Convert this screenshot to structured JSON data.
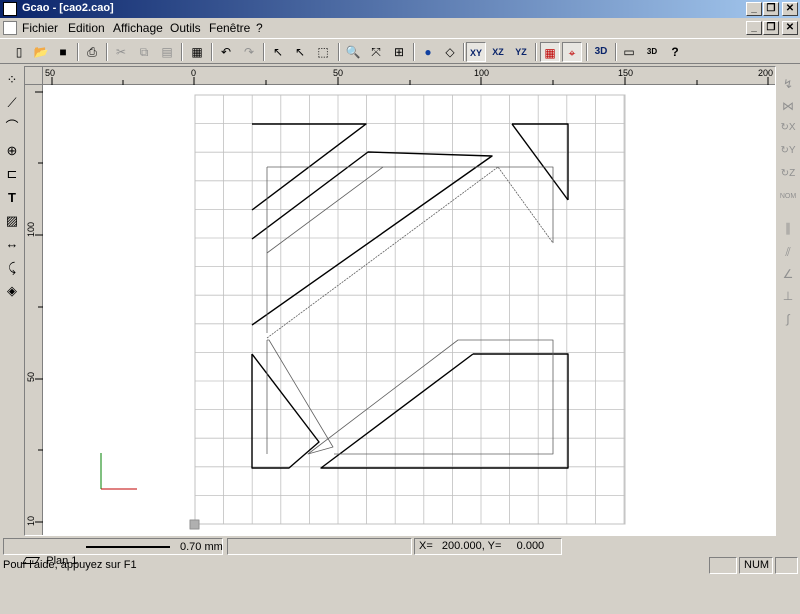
{
  "window": {
    "title": "Gcao - [cao2.cao]",
    "controls": [
      "_",
      "❐",
      "✕"
    ]
  },
  "menubar": {
    "items": [
      "Fichier",
      "Edition",
      "Affichage",
      "Outils",
      "Fenêtre",
      "?"
    ],
    "doc_controls": [
      "_",
      "❐",
      "✕"
    ]
  },
  "toolbar": {
    "buttons": [
      {
        "name": "new-icon",
        "glyph": "▯"
      },
      {
        "name": "open-icon",
        "glyph": "📂"
      },
      {
        "name": "save-icon",
        "glyph": "■"
      },
      {
        "name": "print-icon",
        "glyph": "⎙"
      },
      {
        "name": "cut-icon",
        "glyph": "✂"
      },
      {
        "name": "copy-icon",
        "glyph": "⧉"
      },
      {
        "name": "paste-icon",
        "glyph": "▤"
      },
      {
        "name": "properties-icon",
        "glyph": "▦"
      },
      {
        "name": "undo-icon",
        "glyph": "↶"
      },
      {
        "name": "redo-icon",
        "glyph": "↷"
      },
      {
        "name": "select-arrow-icon",
        "glyph": "↖"
      },
      {
        "name": "select-node-icon",
        "glyph": "↖"
      },
      {
        "name": "zoom-window-icon",
        "glyph": "⬚"
      },
      {
        "name": "zoom-icon",
        "glyph": "🔍"
      },
      {
        "name": "zoom-move-icon",
        "glyph": "⤧"
      },
      {
        "name": "zoom-all-icon",
        "glyph": "⊞"
      },
      {
        "name": "globe-icon",
        "glyph": "●"
      },
      {
        "name": "cube-icon",
        "glyph": "◇"
      },
      {
        "name": "view-xy",
        "glyph": "XY"
      },
      {
        "name": "view-xz",
        "glyph": "XZ"
      },
      {
        "name": "view-yz",
        "glyph": "YZ"
      },
      {
        "name": "grid-red-icon",
        "glyph": "▦"
      },
      {
        "name": "snap-red-icon",
        "glyph": "⌖"
      },
      {
        "name": "view-3d",
        "glyph": "3D"
      },
      {
        "name": "window-icon",
        "glyph": "▭"
      },
      {
        "name": "pro-3d-icon",
        "glyph": "3D"
      },
      {
        "name": "help-cursor-icon",
        "glyph": "?"
      }
    ]
  },
  "left_tools": [
    {
      "name": "points-tool-icon",
      "glyph": "⁘"
    },
    {
      "name": "polyline-tool-icon",
      "glyph": "⟋"
    },
    {
      "name": "curve-tool-icon",
      "glyph": "⌒"
    },
    {
      "name": "circle-tool-icon",
      "glyph": "⊕"
    },
    {
      "name": "rectangle-tool-icon",
      "glyph": "⊏"
    },
    {
      "name": "text-tool-icon",
      "glyph": "T"
    },
    {
      "name": "hatch-tool-icon",
      "glyph": "▨"
    },
    {
      "name": "dimension-tool-icon",
      "glyph": "↔"
    },
    {
      "name": "arc-tool-icon",
      "glyph": "⤹"
    },
    {
      "name": "fill-tool-icon",
      "glyph": "◈"
    }
  ],
  "right_tools": [
    {
      "name": "transform-icon",
      "glyph": "↯"
    },
    {
      "name": "mirror-icon",
      "glyph": "⋈"
    },
    {
      "name": "rotate-x-icon",
      "glyph": "↻X"
    },
    {
      "name": "rotate-y-icon",
      "glyph": "↻Y"
    },
    {
      "name": "rotate-z-icon",
      "glyph": "↻Z"
    },
    {
      "name": "rotate-nom-icon",
      "glyph": "NOM"
    },
    {
      "name": "parallel-icon",
      "glyph": "∥"
    },
    {
      "name": "offset-icon",
      "glyph": "⫽"
    },
    {
      "name": "angle-icon",
      "glyph": "∠"
    },
    {
      "name": "perpendicular-icon",
      "glyph": "⊥"
    },
    {
      "name": "tangent-icon",
      "glyph": "∫"
    }
  ],
  "rulers": {
    "horizontal_labels": [
      "50",
      "0",
      "50",
      "100",
      "150",
      "200"
    ],
    "vertical_labels": [
      "100",
      "50",
      "10"
    ]
  },
  "status": {
    "plan": "Plan 1",
    "line_width": "0.70 mm",
    "coords": "X=   200.000, Y=     0.000",
    "help": "Pour l'aide, appuyez sur F1",
    "num": "NUM"
  },
  "colors": {
    "grid": "#c0c0c0",
    "shape": "#000000",
    "thin": "#808080",
    "axis_x": "#c00000",
    "axis_y": "#008000"
  }
}
